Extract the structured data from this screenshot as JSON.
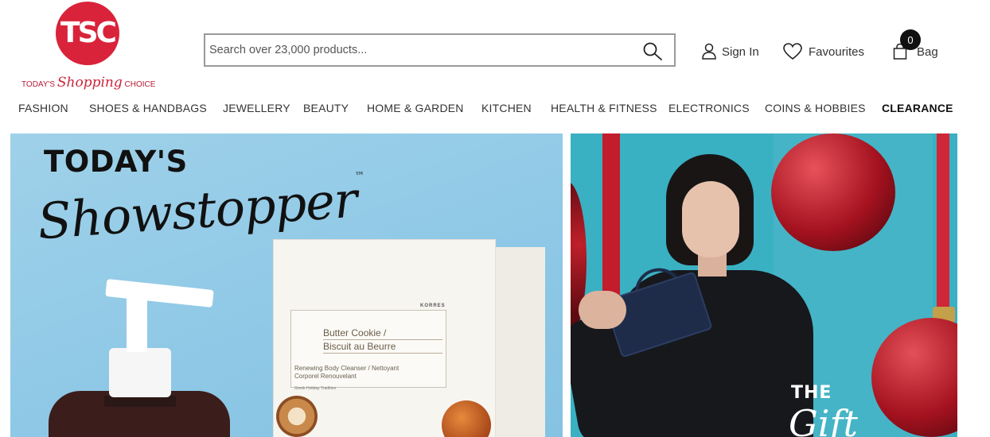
{
  "brand": {
    "logo_letters": "TSC",
    "tagline_left": "TODAY'S",
    "tagline_script": "Shopping",
    "tagline_right": "CHOICE",
    "color": "#d9233b"
  },
  "search": {
    "placeholder": "Search over 23,000 products...",
    "icon": "search-icon"
  },
  "header": {
    "sign_in": "Sign In",
    "favourites": "Favourites",
    "bag": "Bag",
    "bag_count": "0"
  },
  "nav": {
    "items": [
      "FASHION",
      "SHOES & HANDBAGS",
      "JEWELLERY",
      "BEAUTY",
      "HOME & GARDEN",
      "KITCHEN",
      "HEALTH & FITNESS",
      "ELECTRONICS",
      "COINS & HOBBIES",
      "CLEARANCE"
    ]
  },
  "banner_left": {
    "title": "TODAY'S",
    "script": "Showstopper",
    "trademark": "™",
    "product_brand": "KORRES",
    "product_line1": "Butter Cookie /",
    "product_line2": "Biscuit au Beurre",
    "product_desc": "Renewing Body Cleanser / Nettoyant Corporel Renouvelant",
    "product_sub": "Greek Holiday Tradition",
    "bg_color": "#95cce7"
  },
  "banner_right": {
    "overlay_the": "THE",
    "overlay_script": "Gift",
    "bg_color": "#3ab0c3"
  }
}
